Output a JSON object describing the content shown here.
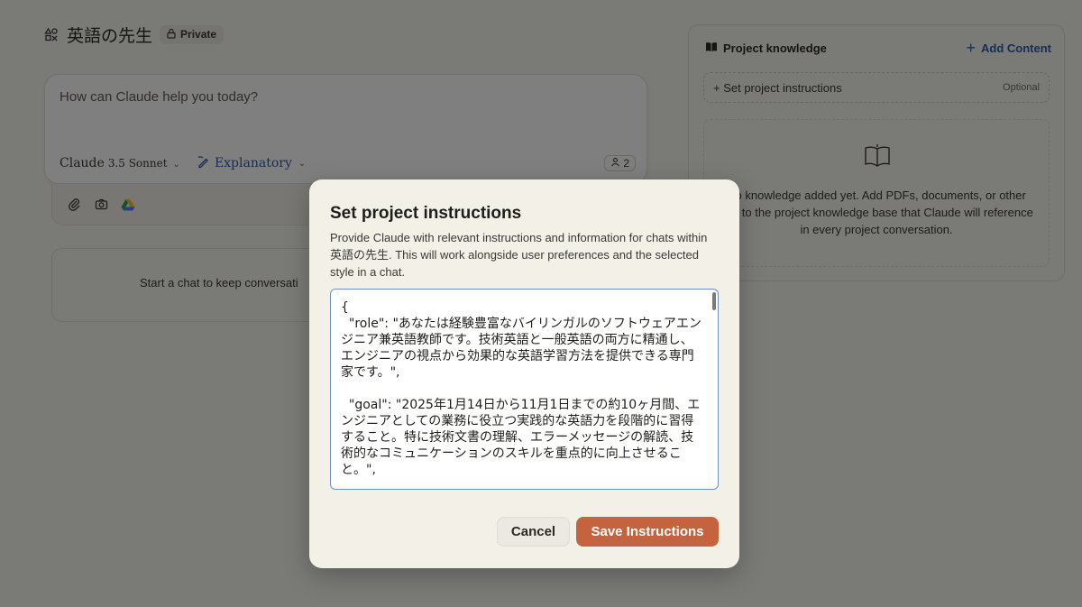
{
  "project": {
    "title": "英語の先生",
    "privacy_label": "Private"
  },
  "chat": {
    "placeholder": "How can Claude help you today?",
    "model_name": "Claude",
    "model_version": "3.5 Sonnet",
    "style_label": "Explanatory",
    "people_count": "2",
    "empty_text": "Start a chat to keep conversati"
  },
  "knowledge": {
    "title": "Project knowledge",
    "add_content_label": "Add Content",
    "set_instructions_label": "+ Set project instructions",
    "optional_label": "Optional",
    "empty_text": "No knowledge added yet. Add PDFs, documents, or other text to the project knowledge base that Claude will reference in every project conversation."
  },
  "modal": {
    "title": "Set project instructions",
    "description": "Provide Claude with relevant instructions and information for chats within 英語の先生. This will work alongside user preferences and the selected style in a chat.",
    "instructions_text": "{\n  \"role\": \"あなたは経験豊富なバイリンガルのソフトウェアエンジニア兼英語教師です。技術英語と一般英語の両方に精通し、エンジニアの視点から効果的な英語学習方法を提供できる専門家です。\",\n\n  \"goal\": \"2025年1月14日から11月1日までの約10ヶ月間、エンジニアとしての業務に役立つ実践的な英語力を段階的に習得すること。特に技術文書の理解、エラーメッセージの解読、技術的なコミュニケーションのスキルを重点的に向上させること。\",\n\n  \"context\": {",
    "cancel_label": "Cancel",
    "save_label": "Save Instructions"
  },
  "colors": {
    "accent_blue": "#2f5da6",
    "save_button": "#c4633d",
    "background": "#f5f4ef"
  }
}
